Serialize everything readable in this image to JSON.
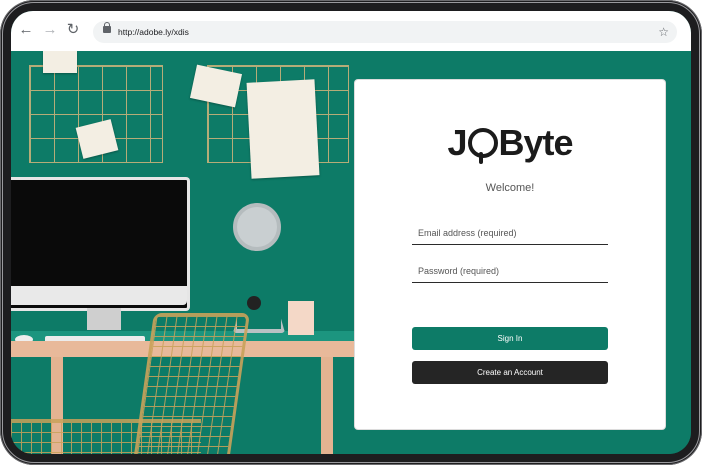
{
  "browser": {
    "url": "http://adobe.ly/xdis",
    "back_icon": "←",
    "forward_icon": "→",
    "reload_icon": "↻",
    "bookmark_icon": "☆"
  },
  "login": {
    "logo_text_left": "J",
    "logo_text_right": "Byte",
    "welcome": "Welcome!",
    "email_placeholder": "Email address (required)",
    "password_placeholder": "Password (required)",
    "signin_label": "Sign In",
    "create_label": "Create an Account"
  },
  "colors": {
    "brand_green": "#0d7b67",
    "dark_button": "#252525"
  }
}
